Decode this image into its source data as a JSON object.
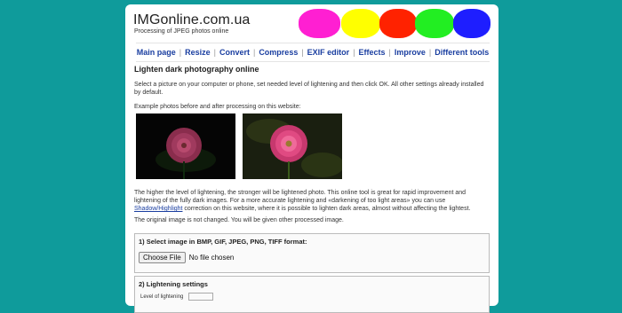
{
  "site": {
    "title": "IMGonline.com.ua",
    "subtitle": "Processing of JPEG photos online"
  },
  "colors": {
    "background": "#0f9b9b",
    "blobs": [
      "#ff1fd2",
      "#ffff00",
      "#ff2200",
      "#22ee22",
      "#1e1eff"
    ]
  },
  "nav": {
    "items": [
      {
        "label": "Main page"
      },
      {
        "label": "Resize"
      },
      {
        "label": "Convert"
      },
      {
        "label": "Compress"
      },
      {
        "label": "EXIF editor"
      },
      {
        "label": "Effects"
      },
      {
        "label": "Improve"
      },
      {
        "label": "Different tools"
      }
    ],
    "separator": "|"
  },
  "main": {
    "heading": "Lighten dark photography online",
    "intro": "Select a picture on your computer or phone, set needed level of lightening and then click OK. All other settings already installed by default.",
    "example_label": "Example photos before and after processing on this website:",
    "desc_part1": "The higher the level of lightening, the stronger will be lightened photo. This online tool is great for rapid improvement and lightening of the fully dark images. For a more accurate lightening and «darkening of too light areas» you can use ",
    "desc_link": "Shadow/Highlight",
    "desc_part2": " correction on this website, where it is possible to lighten dark areas, almost without affecting the lightest.",
    "original_note": "The original image is not changed. You will be given other processed image."
  },
  "step1": {
    "title": "1) Select image in BMP, GIF, JPEG, PNG, TIFF format:",
    "choose_button": "Choose File",
    "file_status": "No file chosen"
  },
  "step2": {
    "title": "2) Lightening settings",
    "row_label": "Level of lightening"
  }
}
